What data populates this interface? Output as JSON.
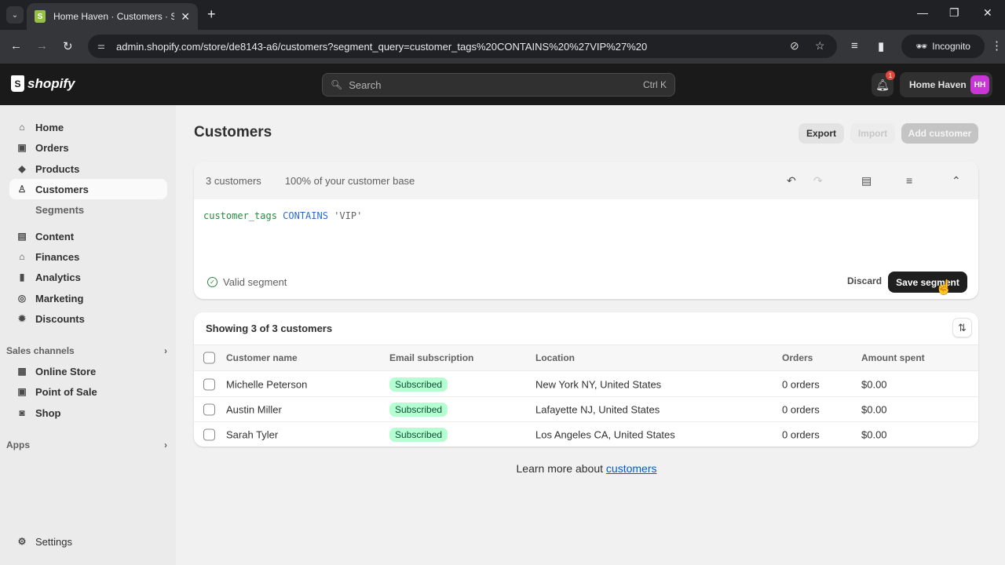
{
  "browser": {
    "tab_title": "Home Haven · Customers · Shopify",
    "url": "admin.shopify.com/store/de8143-a6/customers?segment_query=customer_tags%20CONTAINS%20%27VIP%27%20",
    "incognito_label": "Incognito",
    "new_tab_symbol": "+",
    "close_tab_symbol": "✕"
  },
  "topbar": {
    "brand": "shopify",
    "search_placeholder": "Search",
    "search_shortcut": "Ctrl K",
    "notification_count": "1",
    "store_name": "Home Haven",
    "avatar_initials": "HH",
    "avatar_color": "#c936d5"
  },
  "sidebar": {
    "items": [
      {
        "label": "Home",
        "icon": "home-icon"
      },
      {
        "label": "Orders",
        "icon": "inbox-icon"
      },
      {
        "label": "Products",
        "icon": "tag-icon"
      },
      {
        "label": "Customers",
        "icon": "person-icon",
        "active": true
      },
      {
        "label": "Segments",
        "sub": true
      },
      {
        "label": "Content",
        "icon": "content-icon"
      },
      {
        "label": "Finances",
        "icon": "bank-icon"
      },
      {
        "label": "Analytics",
        "icon": "bar-chart-icon"
      },
      {
        "label": "Marketing",
        "icon": "target-icon"
      },
      {
        "label": "Discounts",
        "icon": "discount-icon"
      }
    ],
    "sales_channels_label": "Sales channels",
    "channels": [
      {
        "label": "Online Store",
        "icon": "store-icon"
      },
      {
        "label": "Point of Sale",
        "icon": "pos-icon"
      },
      {
        "label": "Shop",
        "icon": "shop-icon"
      }
    ],
    "apps_label": "Apps",
    "settings_label": "Settings"
  },
  "main": {
    "title": "Customers",
    "export_label": "Export",
    "import_label": "Import",
    "add_customer_label": "Add customer",
    "segment": {
      "count_text": "3 customers",
      "percent_text": "100% of your customer base",
      "query_attribute": "customer_tags",
      "query_operator": "CONTAINS",
      "query_value": "'VIP'",
      "status_text": "Valid segment",
      "discard_label": "Discard",
      "save_label": "Save segment"
    },
    "table": {
      "title": "Showing 3 of 3 customers",
      "columns": [
        "Customer name",
        "Email subscription",
        "Location",
        "Orders",
        "Amount spent"
      ],
      "rows": [
        {
          "name": "Michelle Peterson",
          "subscription": "Subscribed",
          "location": "New York NY, United States",
          "orders": "0 orders",
          "amount": "$0.00"
        },
        {
          "name": "Austin Miller",
          "subscription": "Subscribed",
          "location": "Lafayette NJ, United States",
          "orders": "0 orders",
          "amount": "$0.00"
        },
        {
          "name": "Sarah Tyler",
          "subscription": "Subscribed",
          "location": "Los Angeles CA, United States",
          "orders": "0 orders",
          "amount": "$0.00"
        }
      ]
    },
    "learn_more_prefix": "Learn more about ",
    "learn_more_link": "customers"
  }
}
